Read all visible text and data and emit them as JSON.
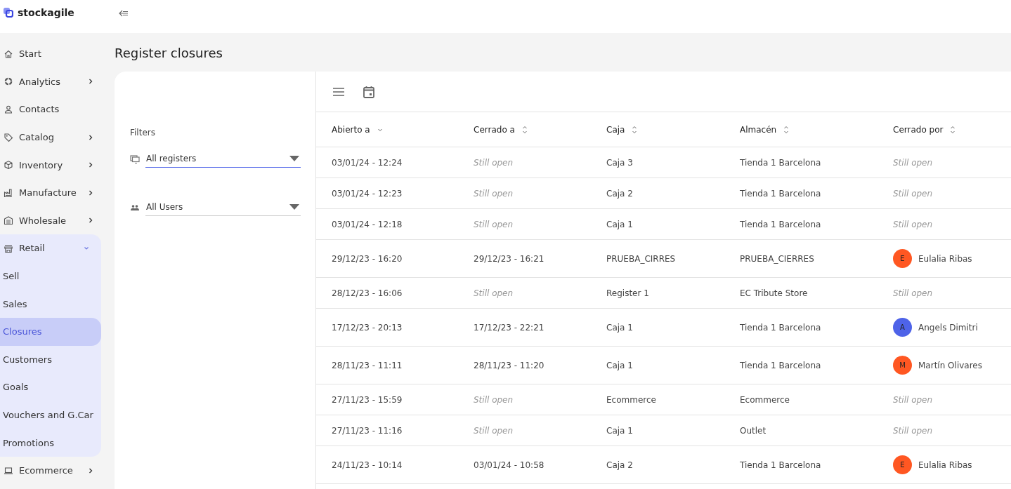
{
  "brand": "stockagile",
  "sidebar": {
    "items": [
      {
        "label": "Start"
      },
      {
        "label": "Analytics",
        "expanded": false
      },
      {
        "label": "Contacts"
      },
      {
        "label": "Catalog",
        "expanded": false
      },
      {
        "label": "Inventory",
        "expanded": false
      },
      {
        "label": "Manufacture",
        "expanded": false
      },
      {
        "label": "Wholesale",
        "expanded": false
      },
      {
        "label": "Retail",
        "expanded": true,
        "children": [
          {
            "label": "Sell",
            "selected": false
          },
          {
            "label": "Sales",
            "selected": false
          },
          {
            "label": "Closures",
            "selected": true
          },
          {
            "label": "Customers",
            "selected": false
          },
          {
            "label": "Goals",
            "selected": false
          },
          {
            "label": "Vouchers and G.Car",
            "selected": false
          },
          {
            "label": "Promotions",
            "selected": false
          }
        ]
      },
      {
        "label": "Ecommerce",
        "expanded": false
      }
    ]
  },
  "page_title": "Register closures",
  "filters": {
    "title": "Filters",
    "fields": [
      {
        "value": "All registers",
        "focused": true
      },
      {
        "value": "All Users",
        "focused": false
      }
    ]
  },
  "table": {
    "columns": [
      {
        "label": "Abierto a",
        "sorted": true
      },
      {
        "label": "Cerrado a",
        "sorted": false
      },
      {
        "label": "Caja",
        "sorted": false
      },
      {
        "label": "Almacén",
        "sorted": false
      },
      {
        "label": "Cerrado por",
        "sorted": false
      }
    ],
    "rows": [
      {
        "opened": "03/01/24 - 12:24",
        "closed": {
          "kind": "pending",
          "text": "Still open"
        },
        "register": "Caja 3",
        "warehouse": "Tienda 1 Barcelona",
        "closed_by": {
          "kind": "pending",
          "text": "Still open"
        }
      },
      {
        "opened": "03/01/24 - 12:23",
        "closed": {
          "kind": "pending",
          "text": "Still open"
        },
        "register": "Caja 2",
        "warehouse": "Tienda 1 Barcelona",
        "closed_by": {
          "kind": "pending",
          "text": "Still open"
        }
      },
      {
        "opened": "03/01/24 - 12:18",
        "closed": {
          "kind": "pending",
          "text": "Still open"
        },
        "register": "Caja 1",
        "warehouse": "Tienda 1 Barcelona",
        "closed_by": {
          "kind": "pending",
          "text": "Still open"
        }
      },
      {
        "opened": "29/12/23 - 16:20",
        "closed": {
          "kind": "date",
          "text": "29/12/23 - 16:21"
        },
        "register": "PRUEBA_CIRRES",
        "warehouse": "PRUEBA_CIERRES",
        "closed_by": {
          "kind": "user",
          "initial": "E",
          "text": "Eulalia Ribas",
          "color": "#ff5722"
        }
      },
      {
        "opened": "28/12/23 - 16:06",
        "closed": {
          "kind": "pending",
          "text": "Still open"
        },
        "register": "Register 1",
        "warehouse": "EC Tribute Store",
        "closed_by": {
          "kind": "pending",
          "text": "Still open"
        }
      },
      {
        "opened": "17/12/23 - 20:13",
        "closed": {
          "kind": "date",
          "text": "17/12/23 - 22:21"
        },
        "register": "Caja 1",
        "warehouse": "Tienda 1 Barcelona",
        "closed_by": {
          "kind": "user",
          "initial": "A",
          "text": "Angels Dimitri",
          "color": "#4e63e8"
        }
      },
      {
        "opened": "28/11/23 - 11:11",
        "closed": {
          "kind": "date",
          "text": "28/11/23 - 11:20"
        },
        "register": "Caja 1",
        "warehouse": "Tienda 1 Barcelona",
        "closed_by": {
          "kind": "user",
          "initial": "M",
          "text": "Martín Olivares",
          "color": "#ff5722"
        }
      },
      {
        "opened": "27/11/23 - 15:59",
        "closed": {
          "kind": "pending",
          "text": "Still open"
        },
        "register": "Ecommerce",
        "warehouse": "Ecommerce",
        "closed_by": {
          "kind": "pending",
          "text": "Still open"
        }
      },
      {
        "opened": "27/11/23 - 11:16",
        "closed": {
          "kind": "pending",
          "text": "Still open"
        },
        "register": "Caja 1",
        "warehouse": "Outlet",
        "closed_by": {
          "kind": "pending",
          "text": "Still open"
        }
      },
      {
        "opened": "24/11/23 - 10:14",
        "closed": {
          "kind": "date",
          "text": "03/01/24 - 10:58"
        },
        "register": "Caja 2",
        "warehouse": "Tienda 1 Barcelona",
        "closed_by": {
          "kind": "user",
          "initial": "E",
          "text": "Eulalia Ribas",
          "color": "#ff5722"
        }
      }
    ]
  }
}
